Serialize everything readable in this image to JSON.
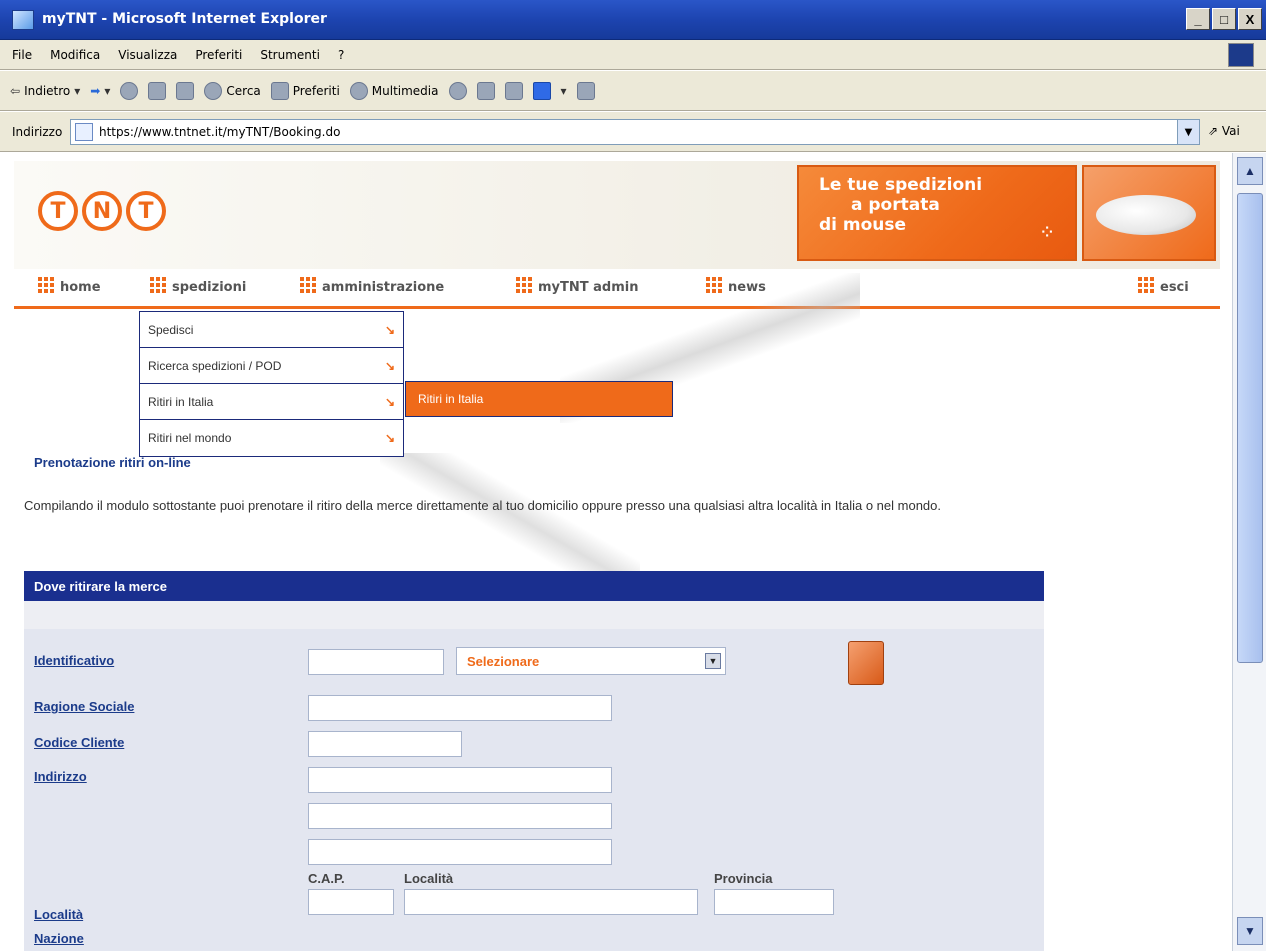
{
  "window": {
    "title": "myTNT - Microsoft Internet Explorer",
    "buttons": [
      "_",
      "□",
      "X"
    ]
  },
  "menubar": [
    "File",
    "Modifica",
    "Visualizza",
    "Preferiti",
    "Strumenti",
    "?"
  ],
  "toolbar": {
    "back": "Indietro",
    "search": "Cerca",
    "favorites": "Preferiti",
    "media": "Multimedia"
  },
  "address": {
    "label": "Indirizzo",
    "url": "https://www.tntnet.it/myTNT/Booking.do",
    "go": "Vai"
  },
  "header": {
    "logo": [
      "T",
      "N",
      "T"
    ],
    "banner_l1": "Le tue spedizioni",
    "banner_l2": "a portata",
    "banner_l3": "di mouse"
  },
  "nav": {
    "home": "home",
    "spedizioni": "spedizioni",
    "amministrazione": "amministrazione",
    "admin": "myTNT admin",
    "news": "news",
    "esci": "esci"
  },
  "dropdown": [
    {
      "label": "Spedisci"
    },
    {
      "label": "Ricerca spedizioni / POD"
    },
    {
      "label": "Ritiri in Italia"
    },
    {
      "label": "Ritiri nel mondo"
    }
  ],
  "submenu": "Ritiri in Italia",
  "page": {
    "title": "Prenotazione ritiri on-line",
    "intro": "Compilando il modulo sottostante puoi prenotare il ritiro della merce direttamente al tuo domicilio oppure presso una qualsiasi altra località in Italia o nel mondo."
  },
  "form": {
    "header": "Dove ritirare la merce",
    "identificativo": "Identificativo",
    "select_value": "Selezionare",
    "ragione_sociale": "Ragione Sociale",
    "codice_cliente": "Codice Cliente",
    "indirizzo": "Indirizzo",
    "cap": "C.A.P.",
    "localita_col": "Località",
    "provincia": "Provincia",
    "localita": "Località",
    "nazione": "Nazione"
  },
  "colors": {
    "accent": "#ef6a1a",
    "nav_blue": "#1a2f8f",
    "link_blue": "#1b3b8a"
  }
}
